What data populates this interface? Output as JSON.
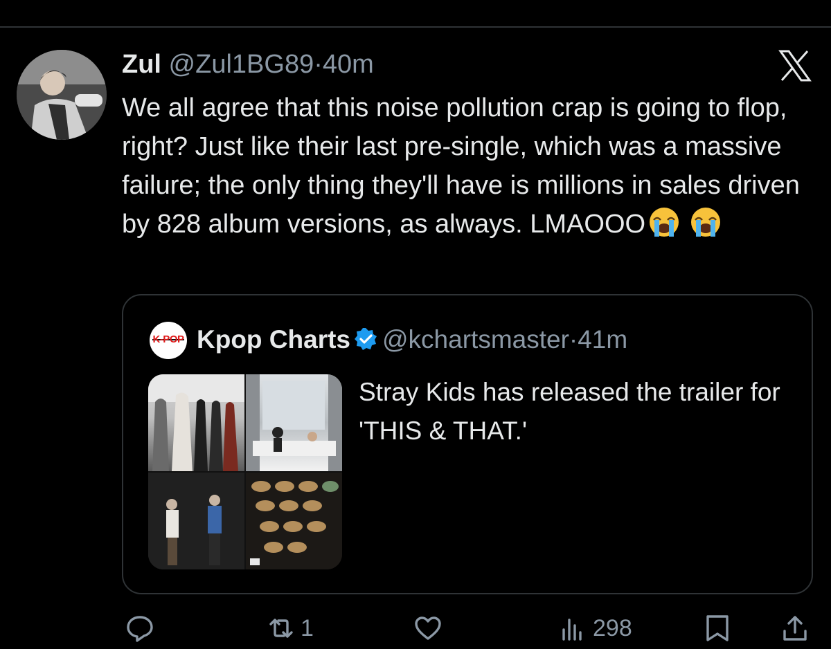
{
  "tweet": {
    "author_name": "Zul",
    "handle": "@Zul1BG89",
    "separator": "·",
    "time": "40m",
    "text": "We all agree that this noise pollution crap is going to flop, right? Just like their last pre-single, which was a massive failure; the only thing they'll have is millions in sales driven by 828 album versions, as always. LMAOOO",
    "emoji": [
      "crying-face",
      "crying-face"
    ]
  },
  "quoted": {
    "avatar_text": "K-POP",
    "author_name": "Kpop Charts",
    "verified": true,
    "handle": "@kchartsmaster",
    "separator": "·",
    "time": "41m",
    "text": "Stray Kids has released the trailer for 'THIS & THAT.'"
  },
  "actions": {
    "reply_icon": "reply-icon",
    "retweet_icon": "retweet-icon",
    "retweet_count": "1",
    "like_icon": "heart-icon",
    "views_icon": "views-icon",
    "views_count": "298",
    "bookmark_icon": "bookmark-icon",
    "share_icon": "share-icon"
  },
  "colors": {
    "background": "#000000",
    "text": "#e7e9ea",
    "muted": "#8b98a5",
    "border": "#2f3336",
    "verified": "#1d9bf0"
  }
}
